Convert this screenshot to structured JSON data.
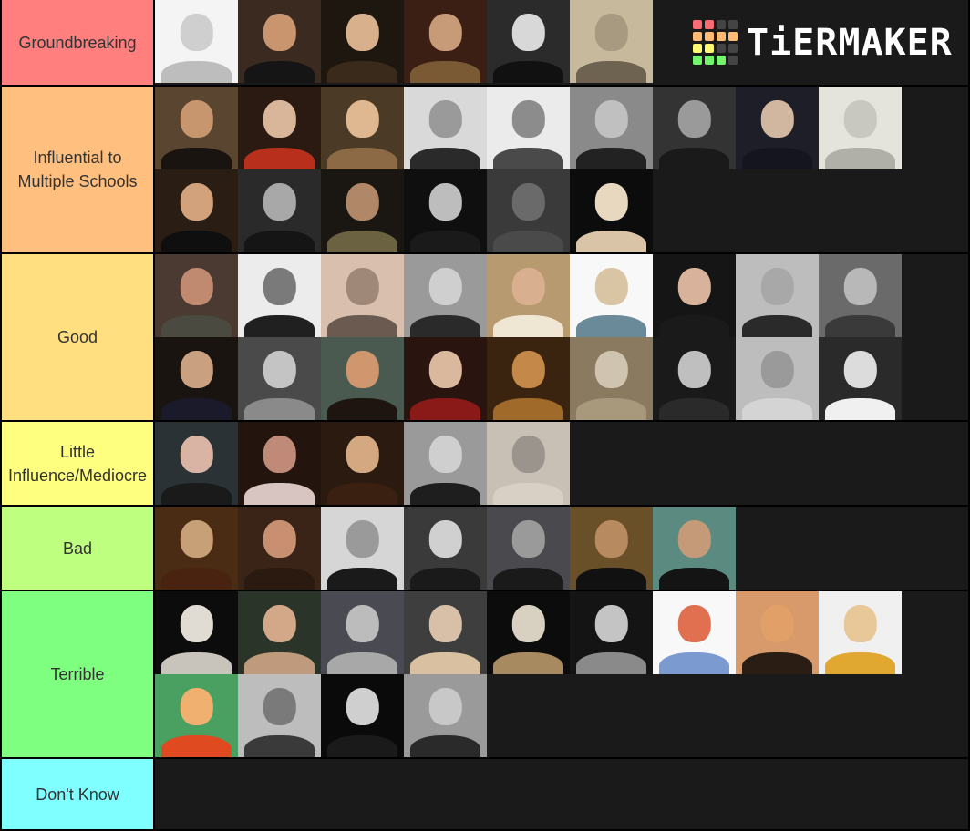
{
  "logo": {
    "text": "TiERMAKER",
    "grid": [
      "#f76b72",
      "#f76b72",
      "#444444",
      "#444444",
      "#ffbb73",
      "#ffbb73",
      "#ffbb73",
      "#ffbb73",
      "#fffa73",
      "#fffa73",
      "#444444",
      "#444444",
      "#74f46d",
      "#74f46d",
      "#74f46d",
      "#444444"
    ]
  },
  "tiers": [
    {
      "label": "Groundbreaking",
      "color": "#ff7f7f",
      "items": [
        {
          "bg": "#f4f4f4",
          "skin": "#cfcfcf",
          "cloth": "#bdbdbd"
        },
        {
          "bg": "#3a2a20",
          "skin": "#c9956f",
          "cloth": "#151515"
        },
        {
          "bg": "#1e1710",
          "skin": "#d9b08c",
          "cloth": "#3a2a1c"
        },
        {
          "bg": "#3b1f14",
          "skin": "#c79a78",
          "cloth": "#7a5a35"
        },
        {
          "bg": "#2b2b2b",
          "skin": "#d8d8d8",
          "cloth": "#111111"
        },
        {
          "bg": "#c7b99c",
          "skin": "#a89a80",
          "cloth": "#6e6350"
        }
      ]
    },
    {
      "label": "Influential to Multiple Schools",
      "color": "#ffbf7f",
      "items": [
        {
          "bg": "#5a4530",
          "skin": "#c8966e",
          "cloth": "#1a1410"
        },
        {
          "bg": "#2a1a12",
          "skin": "#d9b599",
          "cloth": "#b8301c"
        },
        {
          "bg": "#4a3a26",
          "skin": "#dfb892",
          "cloth": "#8c6a45"
        },
        {
          "bg": "#d9d9d9",
          "skin": "#9a9a9a",
          "cloth": "#2a2a2a"
        },
        {
          "bg": "#ebebeb",
          "skin": "#8c8c8c",
          "cloth": "#4a4a4a"
        },
        {
          "bg": "#8a8a8a",
          "skin": "#c0c0c0",
          "cloth": "#222222"
        },
        {
          "bg": "#333333",
          "skin": "#9a9a9a",
          "cloth": "#1a1a1a"
        },
        {
          "bg": "#1e1e28",
          "skin": "#d2b7a0",
          "cloth": "#151520"
        },
        {
          "bg": "#e4e4dc",
          "skin": "#c8c8c0",
          "cloth": "#b0b0a8"
        },
        {
          "bg": "#2a1e14",
          "skin": "#d1a27c",
          "cloth": "#0f0f0f"
        },
        {
          "bg": "#2a2a2a",
          "skin": "#a8a8a8",
          "cloth": "#151515"
        },
        {
          "bg": "#1a1612",
          "skin": "#b08868",
          "cloth": "#6a6240"
        },
        {
          "bg": "#0f0f0f",
          "skin": "#bdbdbd",
          "cloth": "#1a1a1a"
        },
        {
          "bg": "#3a3a3a",
          "skin": "#6a6a6a",
          "cloth": "#4a4a4a"
        },
        {
          "bg": "#0c0c0c",
          "skin": "#e8d8c0",
          "cloth": "#d9c4a8"
        }
      ]
    },
    {
      "label": "Good",
      "color": "#ffdf7f",
      "items": [
        {
          "bg": "#4a3a32",
          "skin": "#c08a70",
          "cloth": "#4a4a40"
        },
        {
          "bg": "#ececec",
          "skin": "#7a7a7a",
          "cloth": "#202020"
        },
        {
          "bg": "#d9bfae",
          "skin": "#a08878",
          "cloth": "#6a5a50"
        },
        {
          "bg": "#9a9a9a",
          "skin": "#cfcfcf",
          "cloth": "#2a2a2a"
        },
        {
          "bg": "#b89a70",
          "skin": "#d8b090",
          "cloth": "#efe6d4"
        },
        {
          "bg": "#f8f8f8",
          "skin": "#d9c4a4",
          "cloth": "#6a8a9a"
        },
        {
          "bg": "#151515",
          "skin": "#d8b29a",
          "cloth": "#1a1a1a"
        },
        {
          "bg": "#bdbdbd",
          "skin": "#a8a8a8",
          "cloth": "#2a2a2a"
        },
        {
          "bg": "#6a6a6a",
          "skin": "#b8b8b8",
          "cloth": "#3a3a3a"
        },
        {
          "bg": "#1a1410",
          "skin": "#c9a080",
          "cloth": "#1a1a2a"
        },
        {
          "bg": "#4a4a4a",
          "skin": "#c4c4c4",
          "cloth": "#8a8a8a"
        },
        {
          "bg": "#4a5a50",
          "skin": "#d0966e",
          "cloth": "#1e1410"
        },
        {
          "bg": "#2a1410",
          "skin": "#dab89e",
          "cloth": "#8a1a18"
        },
        {
          "bg": "#3a2410",
          "skin": "#c48848",
          "cloth": "#a06a2a"
        },
        {
          "bg": "#8a7a60",
          "skin": "#cfc4b0",
          "cloth": "#a8987c"
        },
        {
          "bg": "#1a1a1a",
          "skin": "#bfbfbf",
          "cloth": "#2a2a2a"
        },
        {
          "bg": "#bdbdbd",
          "skin": "#9a9a9a",
          "cloth": "#d4d4d4"
        },
        {
          "bg": "#2a2a2a",
          "skin": "#dcdcdc",
          "cloth": "#f0f0f0"
        }
      ]
    },
    {
      "label": "Little Influence/Mediocre",
      "color": "#ffff7f",
      "items": [
        {
          "bg": "#2a3236",
          "skin": "#d9b4a4",
          "cloth": "#1a1a1a"
        },
        {
          "bg": "#24140e",
          "skin": "#c08a78",
          "cloth": "#d8c4c0"
        },
        {
          "bg": "#2a1a10",
          "skin": "#d4a880",
          "cloth": "#3a2010"
        },
        {
          "bg": "#9a9a9a",
          "skin": "#cfcfcf",
          "cloth": "#1e1e1e"
        },
        {
          "bg": "#c8c0b4",
          "skin": "#9a948c",
          "cloth": "#d8d0c4"
        }
      ]
    },
    {
      "label": "Bad",
      "color": "#bfff7f",
      "items": [
        {
          "bg": "#4a2c14",
          "skin": "#c8a078",
          "cloth": "#4a2210"
        },
        {
          "bg": "#3a2418",
          "skin": "#c89070",
          "cloth": "#2a1a10"
        },
        {
          "bg": "#d6d6d6",
          "skin": "#9a9a9a",
          "cloth": "#1a1a1a"
        },
        {
          "bg": "#3a3a3a",
          "skin": "#d0d0d0",
          "cloth": "#1a1a1a"
        },
        {
          "bg": "#4a4a4e",
          "skin": "#9a9a9a",
          "cloth": "#1a1a1a"
        },
        {
          "bg": "#6a5028",
          "skin": "#b88a60",
          "cloth": "#111111"
        },
        {
          "bg": "#5a8a80",
          "skin": "#c49a78",
          "cloth": "#141414"
        }
      ]
    },
    {
      "label": "Terrible",
      "color": "#7fff7f",
      "items": [
        {
          "bg": "#0c0c0c",
          "skin": "#e0dcd4",
          "cloth": "#c8c4bc"
        },
        {
          "bg": "#2a3428",
          "skin": "#d2a888",
          "cloth": "#bf9a7c"
        },
        {
          "bg": "#4a4a52",
          "skin": "#bcbcbc",
          "cloth": "#a8a8a8"
        },
        {
          "bg": "#3e3e3e",
          "skin": "#d8c0a8",
          "cloth": "#d8c0a0"
        },
        {
          "bg": "#0c0c0c",
          "skin": "#d8d0c0",
          "cloth": "#a88a60"
        },
        {
          "bg": "#141414",
          "skin": "#c4c4c4",
          "cloth": "#8a8a8a"
        },
        {
          "bg": "#f8f8f8",
          "skin": "#e07050",
          "cloth": "#7a9ad0"
        },
        {
          "bg": "#d89a6a",
          "skin": "#e0a068",
          "cloth": "#2a1e14"
        },
        {
          "bg": "#f0f0f0",
          "skin": "#e8c898",
          "cloth": "#e0a830"
        },
        {
          "bg": "#4aa060",
          "skin": "#f0b070",
          "cloth": "#e04a20"
        },
        {
          "bg": "#bdbdbd",
          "skin": "#7a7a7a",
          "cloth": "#3a3a3a"
        },
        {
          "bg": "#0a0a0a",
          "skin": "#cfcfcf",
          "cloth": "#1a1a1a"
        },
        {
          "bg": "#9a9a9a",
          "skin": "#c8c8c8",
          "cloth": "#2a2a2a"
        }
      ]
    },
    {
      "label": "Don't Know",
      "color": "#7fffff",
      "items": []
    }
  ]
}
